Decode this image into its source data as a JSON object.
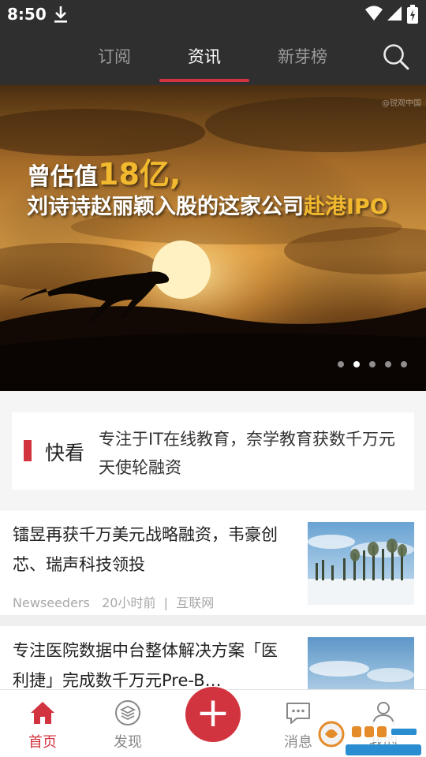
{
  "status_bar": {
    "time": "8:50"
  },
  "top_tabs": {
    "items": [
      {
        "label": "订阅"
      },
      {
        "label": "资讯"
      },
      {
        "label": "新芽榜"
      }
    ],
    "active_index": 1
  },
  "banner": {
    "watermark": "@锐观中国",
    "headline_prefix": "曾估值",
    "headline_value": "18亿,",
    "subheadline_prefix": "刘诗诗赵丽颖入股的这家公司",
    "subheadline_highlight": "赴港IPO",
    "slide_count": 5,
    "active_slide": 1
  },
  "quick_look": {
    "label": "快看",
    "text": "专注于IT在线教育，奈学教育获数千万元天使轮融资"
  },
  "news": [
    {
      "title": "镭昱再获千万美元战略融资，韦豪创芯、瑞声科技领投",
      "source": "Newseeders",
      "time": "20小时前",
      "category": "互联网"
    },
    {
      "title": "专注医院数据中台整体解决方案「医利捷」完成数千万元Pre-B…"
    }
  ],
  "bottom_nav": {
    "items": [
      {
        "label": "首页",
        "icon": "home-icon"
      },
      {
        "label": "发现",
        "icon": "layers-icon"
      },
      {
        "label": "消息",
        "icon": "chat-icon"
      },
      {
        "label": "我的",
        "icon": "user-icon"
      }
    ],
    "active_index": 0,
    "publish_icon": "plus-icon"
  },
  "colors": {
    "accent": "#d2343f",
    "topbar": "#2f2f2f",
    "highlight": "#f2b92f"
  }
}
